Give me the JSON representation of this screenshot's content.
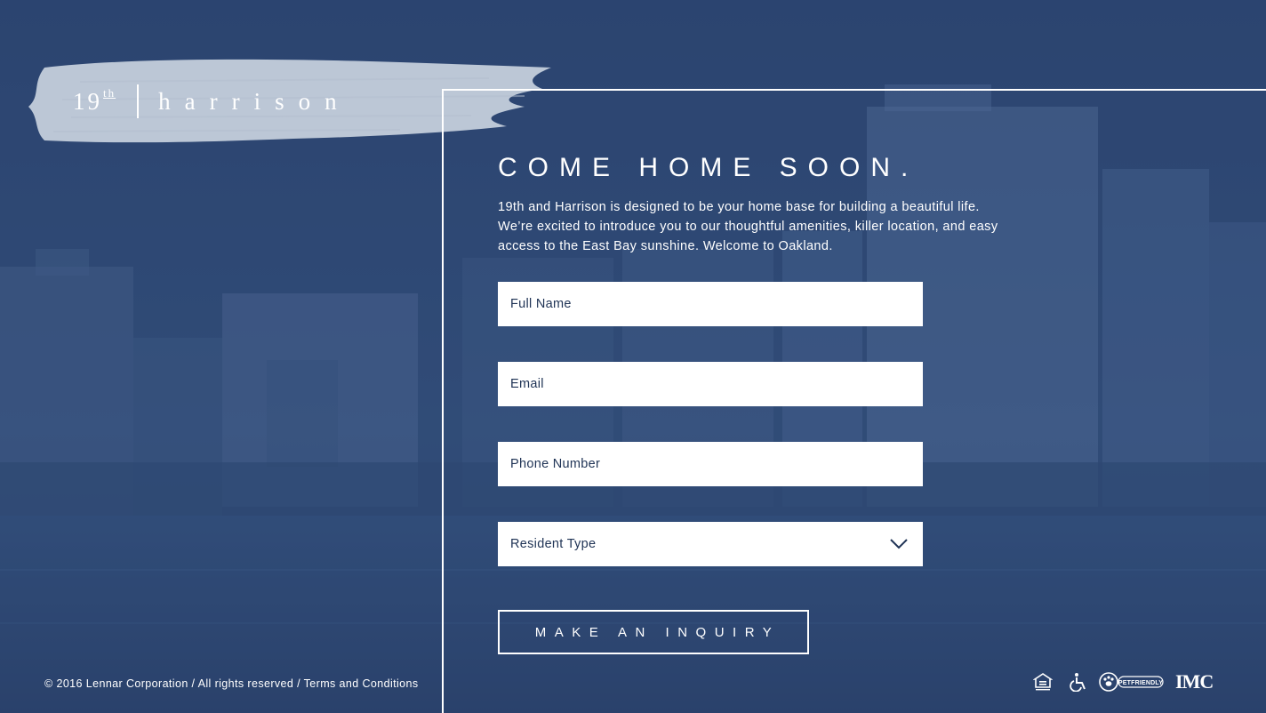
{
  "brand": {
    "logo_number": "19",
    "logo_superscript": "th",
    "logo_name": "harrison"
  },
  "hero": {
    "headline": "COME HOME SOON.",
    "intro": "19th and Harrison is designed to be your home base for building a beautiful life. We’re excited to introduce you to our thoughtful amenities, killer location, and easy access to the East Bay sunshine. Welcome to Oakland."
  },
  "form": {
    "full_name_placeholder": "Full Name",
    "email_placeholder": "Email",
    "phone_placeholder": "Phone Number",
    "resident_type_label": "Resident Type",
    "submit_label": "MAKE AN INQUIRY"
  },
  "footer": {
    "copyright": "© 2016 Lennar Corporation / All rights reserved / ",
    "terms_link": "Terms and Conditions"
  },
  "badges": {
    "pet_friendly": "PETFRIENDLY",
    "company_logo": "IMC",
    "icons": [
      "equal-housing-icon",
      "accessibility-icon",
      "pet-friendly-icon",
      "imc-logo"
    ]
  },
  "colors": {
    "background_overlay": "#2e4872",
    "text_primary": "#ffffff",
    "input_text": "#1f3355",
    "brush_stroke": "#c9d2de"
  }
}
